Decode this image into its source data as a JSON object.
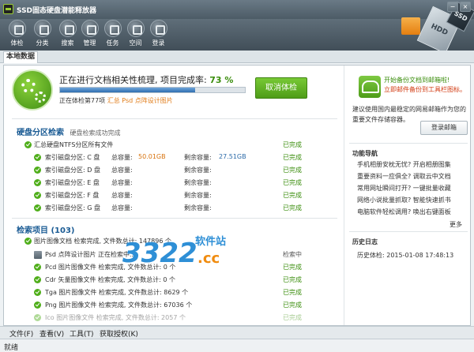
{
  "window": {
    "title": "SSD固态硬盘潜能释放器",
    "controls": {
      "minimize": "−",
      "close": "×"
    }
  },
  "toolbar": {
    "items": [
      {
        "label": "体检",
        "icon": "play-icon"
      },
      {
        "label": "分类",
        "icon": "category-icon"
      },
      {
        "label": "搜索",
        "icon": "search-icon"
      },
      {
        "label": "管理",
        "icon": "manage-icon"
      },
      {
        "label": "任务",
        "icon": "task-icon"
      },
      {
        "label": "空间",
        "icon": "space-icon"
      },
      {
        "label": "登录",
        "icon": "cloud-icon"
      }
    ]
  },
  "banner": {
    "hdd_label": "HDD",
    "ssd_label": "SSD"
  },
  "tabs": [
    {
      "label": "本地数据"
    }
  ],
  "scan": {
    "status_prefix": "正在进行文档相关性梳理, 项目完成率:",
    "percent": "73 %",
    "progress": 0.73,
    "checking_prefix": "正在体检第77项",
    "checking_file": "汇总 Psd 点阵设计图片",
    "cancel_label": "取消体检"
  },
  "partition": {
    "title": "硬盘分区检索",
    "subtitle": "硬盘检索成功完成",
    "summary": {
      "text": "汇总硬盘NTFS分区所有文件",
      "status": "已完成"
    },
    "drives": [
      {
        "name": "索引磁盘分区: C 盘",
        "total_label": "总容量:",
        "total": "50.01GB",
        "free_label": "剩余容量:",
        "free": "27.51GB",
        "status": "已完成"
      },
      {
        "name": "索引磁盘分区: D 盘",
        "total_label": "总容量:",
        "total": "",
        "free_label": "剩余容量:",
        "free": "",
        "status": "已完成"
      },
      {
        "name": "索引磁盘分区: E 盘",
        "total_label": "总容量:",
        "total": "",
        "free_label": "剩余容量:",
        "free": "",
        "status": "已完成"
      },
      {
        "name": "索引磁盘分区: F 盘",
        "total_label": "总容量:",
        "total": "",
        "free_label": "剩余容量:",
        "free": "",
        "status": "已完成"
      },
      {
        "name": "索引磁盘分区: G 盘",
        "total_label": "总容量:",
        "total": "",
        "free_label": "剩余容量:",
        "free": "",
        "status": "已完成"
      }
    ]
  },
  "items": {
    "title": "检索项目",
    "count": "(103)",
    "summary": {
      "text": "图片图像文档 检索完成, 文件数总计: 147896 个"
    },
    "rows": [
      {
        "text": "Psd 点阵设计图片 正在检索中...",
        "status": "检索中"
      },
      {
        "text": "Pcd 图片图像文件 检索完成, 文件数总计: 0 个",
        "status": "已完成"
      },
      {
        "text": "Cdr 矢量图像文件 检索完成, 文件数总计: 0 个",
        "status": "已完成"
      },
      {
        "text": "Tga 图片图像文件 检索完成, 文件数总计: 8629 个",
        "status": "已完成"
      },
      {
        "text": "Png 图片图像文件 检索完成, 文件数总计: 67036 个",
        "status": "已完成"
      },
      {
        "text": "Ico 图片图像文件 检索完成, 文件数总计: 2057 个",
        "status": "已完成"
      }
    ]
  },
  "watermark": {
    "number": "3322",
    "suffix": ".cc",
    "site": "软件站"
  },
  "promo": {
    "line1": "开始备份文档到邮箱啦!",
    "line2": "立即邮件备份到工具栏图标。",
    "description": "建议使用国内最稳定的网易邮箱作为您的重要文件存储容器。",
    "button": "登录邮箱"
  },
  "nav": {
    "title": "功能导航",
    "items": [
      "手机相册安枕无忧? 开启相册图集",
      "重要资料一应俱全? 调取云中文档",
      "常用网址瞬间打开? 一键批量收藏",
      "网络小说批量抓取? 智能快速抓书",
      "电脑软件轻松调用? 唤出右键面板"
    ],
    "more": "更多"
  },
  "history": {
    "title": "历史日志",
    "entry": "历史体检: 2015-01-08 17:48:13"
  },
  "menubar": {
    "items": [
      "文件(F)",
      "查看(V)",
      "工具(T)",
      "获取授权(K)"
    ]
  },
  "statusbar": {
    "text": "就绪"
  }
}
